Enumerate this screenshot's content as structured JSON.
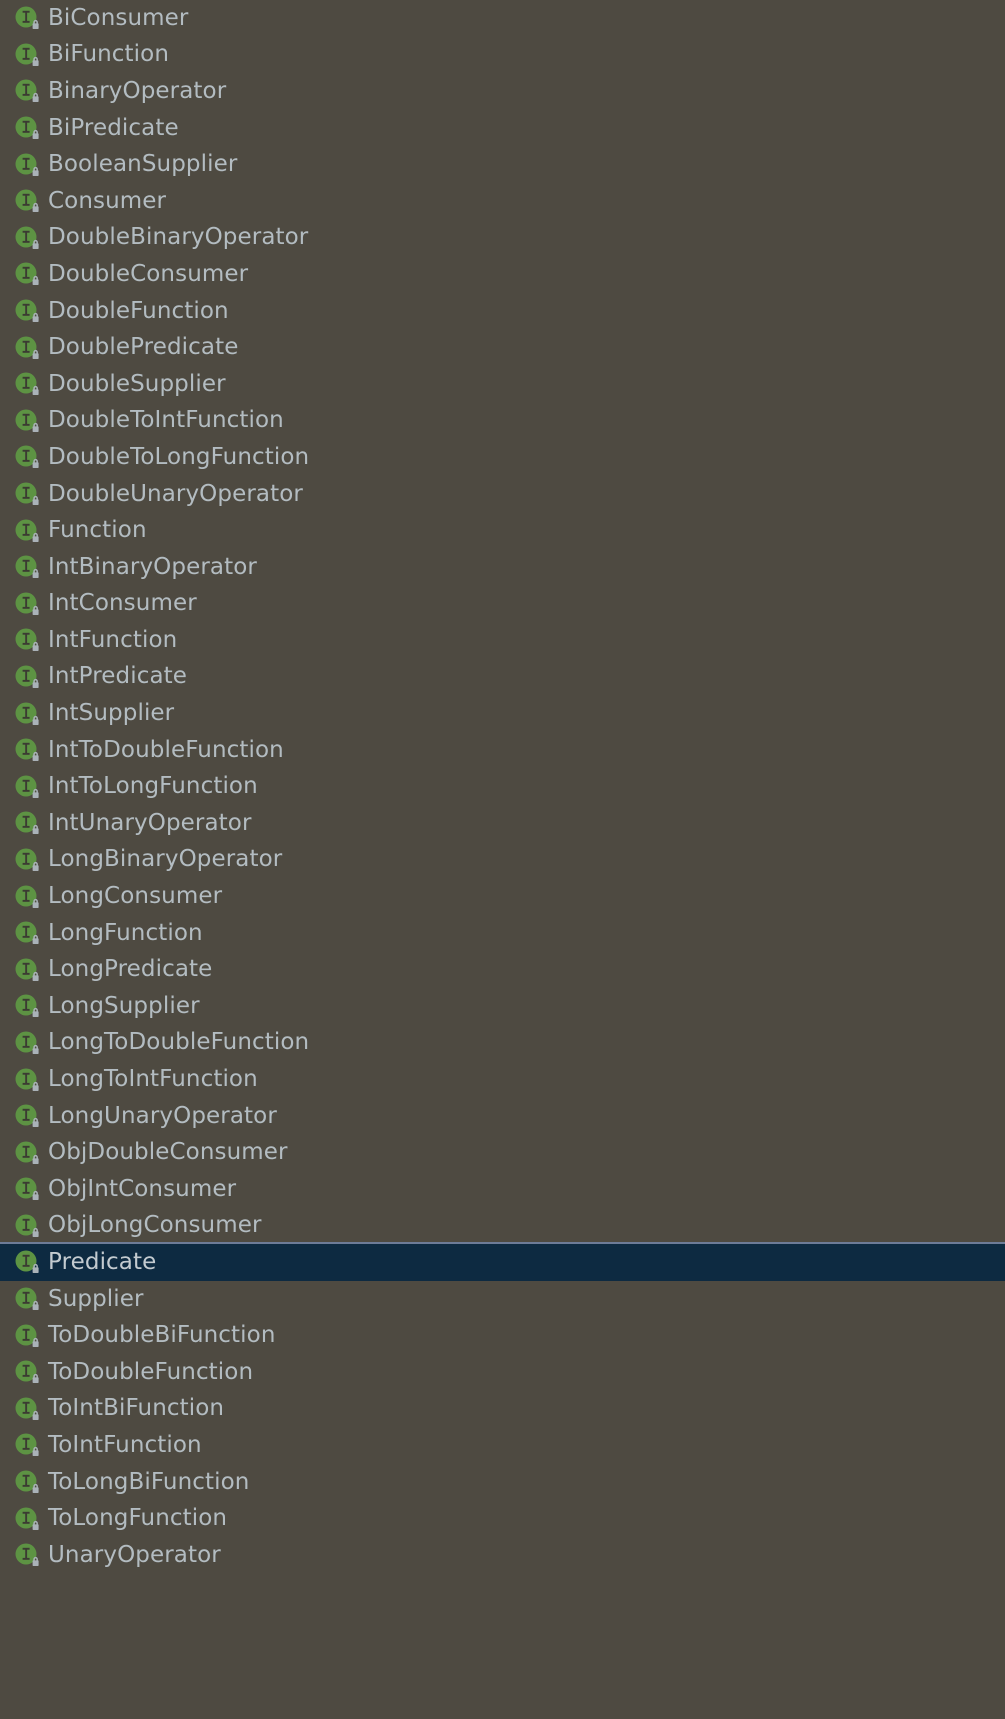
{
  "panel": {
    "name": "interface-completion-list",
    "background_color": "#4e4a41",
    "text_color": "#b3bcc1",
    "selection_background_color": "#0d2a41",
    "selection_border_color": "#6d7c98",
    "icon_color": "#5d9343",
    "icon_letter": "I",
    "icon_badge": "lock-badge",
    "icon_badge_color": "#aab2b8"
  },
  "items": [
    {
      "label": "BiConsumer",
      "icon": "interface-icon",
      "badge": "lock-icon",
      "selected": false
    },
    {
      "label": "BiFunction",
      "icon": "interface-icon",
      "badge": "lock-icon",
      "selected": false
    },
    {
      "label": "BinaryOperator",
      "icon": "interface-icon",
      "badge": "lock-icon",
      "selected": false
    },
    {
      "label": "BiPredicate",
      "icon": "interface-icon",
      "badge": "lock-icon",
      "selected": false
    },
    {
      "label": "BooleanSupplier",
      "icon": "interface-icon",
      "badge": "lock-icon",
      "selected": false
    },
    {
      "label": "Consumer",
      "icon": "interface-icon",
      "badge": "lock-icon",
      "selected": false
    },
    {
      "label": "DoubleBinaryOperator",
      "icon": "interface-icon",
      "badge": "lock-icon",
      "selected": false
    },
    {
      "label": "DoubleConsumer",
      "icon": "interface-icon",
      "badge": "lock-icon",
      "selected": false
    },
    {
      "label": "DoubleFunction",
      "icon": "interface-icon",
      "badge": "lock-icon",
      "selected": false
    },
    {
      "label": "DoublePredicate",
      "icon": "interface-icon",
      "badge": "lock-icon",
      "selected": false
    },
    {
      "label": "DoubleSupplier",
      "icon": "interface-icon",
      "badge": "lock-icon",
      "selected": false
    },
    {
      "label": "DoubleToIntFunction",
      "icon": "interface-icon",
      "badge": "lock-icon",
      "selected": false
    },
    {
      "label": "DoubleToLongFunction",
      "icon": "interface-icon",
      "badge": "lock-icon",
      "selected": false
    },
    {
      "label": "DoubleUnaryOperator",
      "icon": "interface-icon",
      "badge": "lock-icon",
      "selected": false
    },
    {
      "label": "Function",
      "icon": "interface-icon",
      "badge": "lock-icon",
      "selected": false
    },
    {
      "label": "IntBinaryOperator",
      "icon": "interface-icon",
      "badge": "lock-icon",
      "selected": false
    },
    {
      "label": "IntConsumer",
      "icon": "interface-icon",
      "badge": "lock-icon",
      "selected": false
    },
    {
      "label": "IntFunction",
      "icon": "interface-icon",
      "badge": "lock-icon",
      "selected": false
    },
    {
      "label": "IntPredicate",
      "icon": "interface-icon",
      "badge": "lock-icon",
      "selected": false
    },
    {
      "label": "IntSupplier",
      "icon": "interface-icon",
      "badge": "lock-icon",
      "selected": false
    },
    {
      "label": "IntToDoubleFunction",
      "icon": "interface-icon",
      "badge": "lock-icon",
      "selected": false
    },
    {
      "label": "IntToLongFunction",
      "icon": "interface-icon",
      "badge": "lock-icon",
      "selected": false
    },
    {
      "label": "IntUnaryOperator",
      "icon": "interface-icon",
      "badge": "lock-icon",
      "selected": false
    },
    {
      "label": "LongBinaryOperator",
      "icon": "interface-icon",
      "badge": "lock-icon",
      "selected": false
    },
    {
      "label": "LongConsumer",
      "icon": "interface-icon",
      "badge": "lock-icon",
      "selected": false
    },
    {
      "label": "LongFunction",
      "icon": "interface-icon",
      "badge": "lock-icon",
      "selected": false
    },
    {
      "label": "LongPredicate",
      "icon": "interface-icon",
      "badge": "lock-icon",
      "selected": false
    },
    {
      "label": "LongSupplier",
      "icon": "interface-icon",
      "badge": "lock-icon",
      "selected": false
    },
    {
      "label": "LongToDoubleFunction",
      "icon": "interface-icon",
      "badge": "lock-icon",
      "selected": false
    },
    {
      "label": "LongToIntFunction",
      "icon": "interface-icon",
      "badge": "lock-icon",
      "selected": false
    },
    {
      "label": "LongUnaryOperator",
      "icon": "interface-icon",
      "badge": "lock-icon",
      "selected": false
    },
    {
      "label": "ObjDoubleConsumer",
      "icon": "interface-icon",
      "badge": "lock-icon",
      "selected": false
    },
    {
      "label": "ObjIntConsumer",
      "icon": "interface-icon",
      "badge": "lock-icon",
      "selected": false
    },
    {
      "label": "ObjLongConsumer",
      "icon": "interface-icon",
      "badge": "lock-icon",
      "selected": false
    },
    {
      "label": "Predicate",
      "icon": "interface-icon",
      "badge": "lock-icon",
      "selected": true
    },
    {
      "label": "Supplier",
      "icon": "interface-icon",
      "badge": "lock-icon",
      "selected": false
    },
    {
      "label": "ToDoubleBiFunction",
      "icon": "interface-icon",
      "badge": "lock-icon",
      "selected": false
    },
    {
      "label": "ToDoubleFunction",
      "icon": "interface-icon",
      "badge": "lock-icon",
      "selected": false
    },
    {
      "label": "ToIntBiFunction",
      "icon": "interface-icon",
      "badge": "lock-icon",
      "selected": false
    },
    {
      "label": "ToIntFunction",
      "icon": "interface-icon",
      "badge": "lock-icon",
      "selected": false
    },
    {
      "label": "ToLongBiFunction",
      "icon": "interface-icon",
      "badge": "lock-icon",
      "selected": false
    },
    {
      "label": "ToLongFunction",
      "icon": "interface-icon",
      "badge": "lock-icon",
      "selected": false
    },
    {
      "label": "UnaryOperator",
      "icon": "interface-icon",
      "badge": "lock-icon",
      "selected": false
    }
  ]
}
